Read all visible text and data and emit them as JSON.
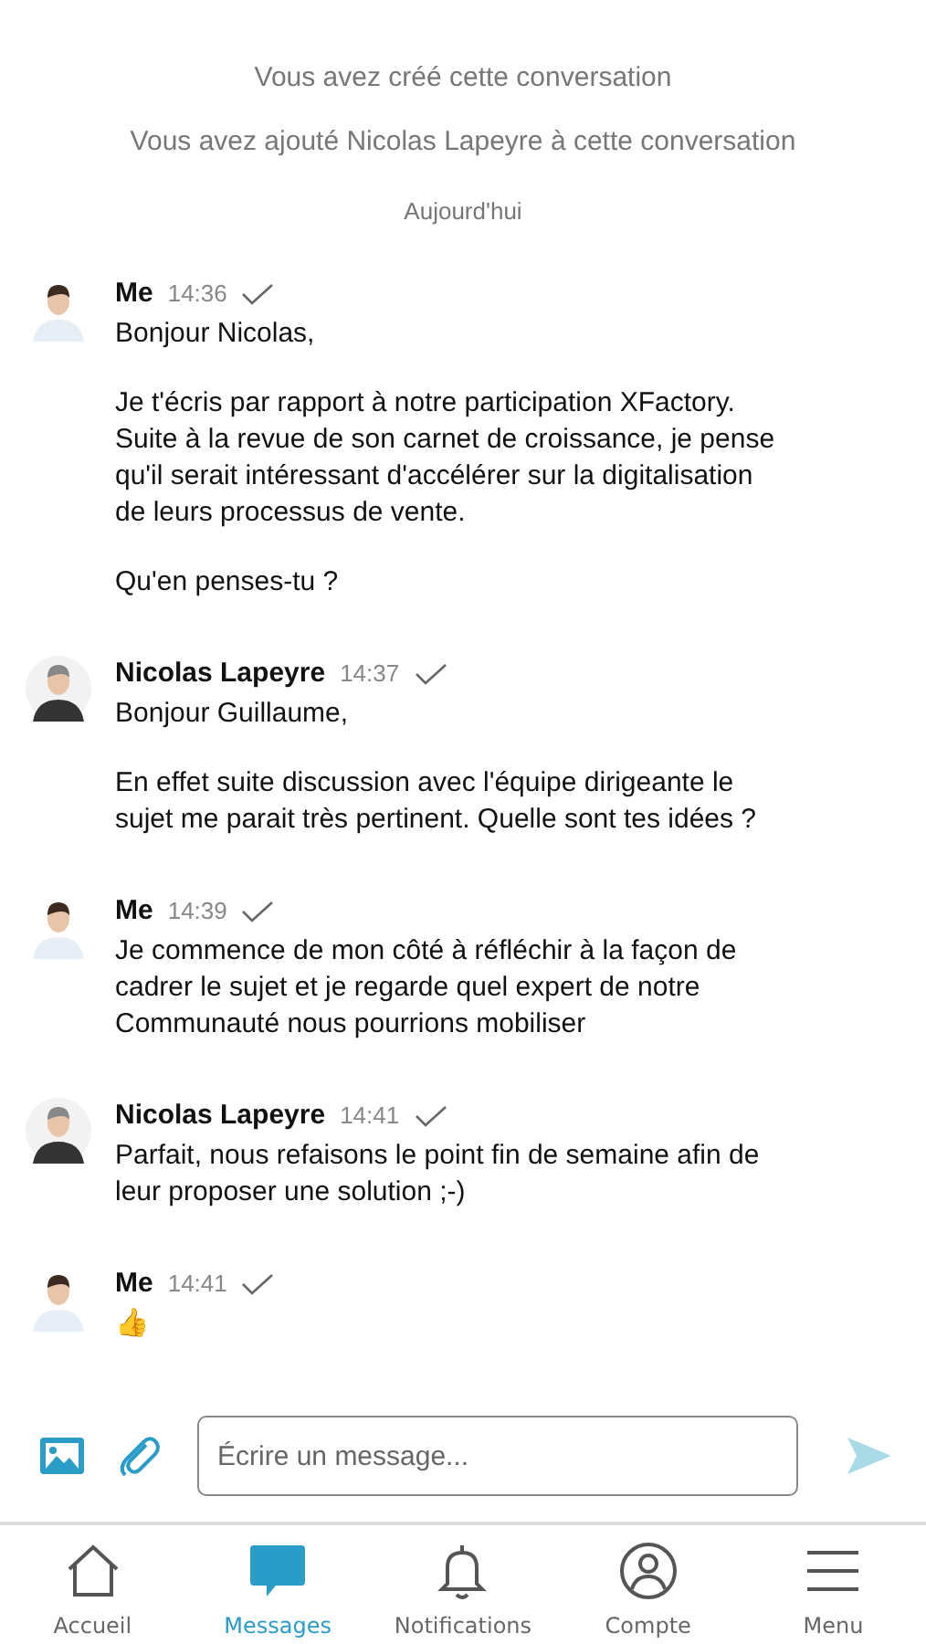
{
  "system_lines": [
    {
      "text": "Vous avez créé cette conversation",
      "kind": "event"
    },
    {
      "text": "Vous avez ajouté Nicolas Lapeyre à cette conversation",
      "kind": "event"
    },
    {
      "text": "Aujourd'hui",
      "kind": "date"
    }
  ],
  "messages": [
    {
      "sender": "Me",
      "time": "14:36",
      "kind": "light",
      "paragraphs": [
        "Bonjour Nicolas,",
        "Je t'écris par rapport à notre participation XFactory. Suite à la revue de son carnet de croissance, je pense qu'il serait intéressant d'accélérer sur la digitalisation de leurs processus de vente.",
        "Qu'en penses-tu ?"
      ]
    },
    {
      "sender": "Nicolas Lapeyre",
      "time": "14:37",
      "kind": "dark",
      "paragraphs": [
        "Bonjour Guillaume,",
        "En effet suite discussion avec l'équipe dirigeante le sujet me parait très pertinent. Quelle sont tes idées ?"
      ]
    },
    {
      "sender": "Me",
      "time": "14:39",
      "kind": "light",
      "paragraphs": [
        "Je commence de mon côté à réfléchir à la façon de cadrer le sujet et je regarde quel expert de notre Communauté nous pourrions mobiliser"
      ]
    },
    {
      "sender": "Nicolas Lapeyre",
      "time": "14:41",
      "kind": "dark",
      "paragraphs": [
        "Parfait, nous refaisons le point fin de semaine afin de leur proposer une solution ;-)"
      ]
    },
    {
      "sender": "Me",
      "time": "14:41",
      "kind": "light",
      "paragraphs": [
        "👍"
      ]
    }
  ],
  "composer": {
    "placeholder": "Écrire un message..."
  },
  "nav": [
    {
      "label": "Accueil",
      "selected": false
    },
    {
      "label": "Messages",
      "selected": true
    },
    {
      "label": "Notifications",
      "selected": false
    },
    {
      "label": "Compte",
      "selected": false
    },
    {
      "label": "Menu",
      "selected": false
    }
  ]
}
